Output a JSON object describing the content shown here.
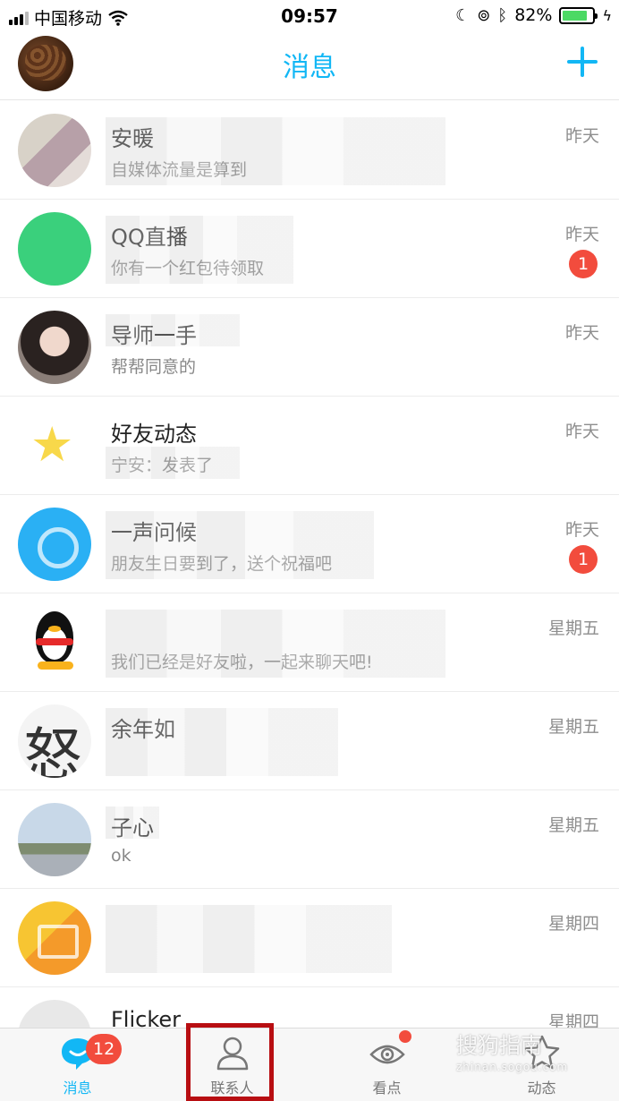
{
  "status_bar": {
    "carrier": "中国移动",
    "time": "09:57",
    "battery": "82%",
    "battery_level": 0.82
  },
  "header": {
    "title": "消息"
  },
  "conversations": [
    {
      "name": "安暖",
      "preview": "自媒体流量是算到",
      "time": "昨天",
      "badge": "",
      "avatar_icon": "user-photo"
    },
    {
      "name": "QQ直播",
      "preview": "你有一个红包待领取",
      "time": "昨天",
      "badge": "1",
      "avatar_icon": "live-icon"
    },
    {
      "name": "导师一手",
      "preview": "帮帮同意的",
      "time": "昨天",
      "badge": "",
      "avatar_icon": "user-photo"
    },
    {
      "name": "好友动态",
      "preview": "宁安：发表了",
      "time": "昨天",
      "badge": "",
      "avatar_icon": "star-icon"
    },
    {
      "name": "一声问候",
      "preview": "朋友生日要到了，送个祝福吧",
      "time": "昨天",
      "badge": "1",
      "avatar_icon": "greeting-icon"
    },
    {
      "name": "",
      "preview": "我们已经是好友啦，一起来聊天吧!",
      "time": "星期五",
      "badge": "",
      "avatar_icon": "penguin-icon"
    },
    {
      "name": "余年如",
      "preview": "",
      "time": "星期五",
      "badge": "",
      "avatar_icon": "user-photo"
    },
    {
      "name": "子心",
      "preview": "ok",
      "time": "星期五",
      "badge": "",
      "avatar_icon": "user-photo"
    },
    {
      "name": "",
      "preview": "",
      "time": "星期四",
      "badge": "",
      "avatar_icon": "folder-icon"
    },
    {
      "name": "Flicker",
      "preview": "",
      "time": "星期四",
      "badge": "",
      "avatar_icon": "user-photo"
    }
  ],
  "tab_bar": {
    "tabs": [
      {
        "label": "消息",
        "badge": "12",
        "icon": "message-icon",
        "active": true
      },
      {
        "label": "联系人",
        "badge": "",
        "icon": "contacts-icon",
        "active": false
      },
      {
        "label": "看点",
        "badge": "",
        "icon": "eye-icon",
        "active": false
      },
      {
        "label": "动态",
        "badge": "",
        "icon": "star-outline-icon",
        "active": false
      }
    ]
  },
  "watermark": {
    "text": "搜狗指南",
    "url": "zhinan.sogou.com"
  },
  "colors": {
    "accent": "#12b7f5",
    "badge_red": "#f24c3d",
    "highlight": "#b80e12"
  }
}
